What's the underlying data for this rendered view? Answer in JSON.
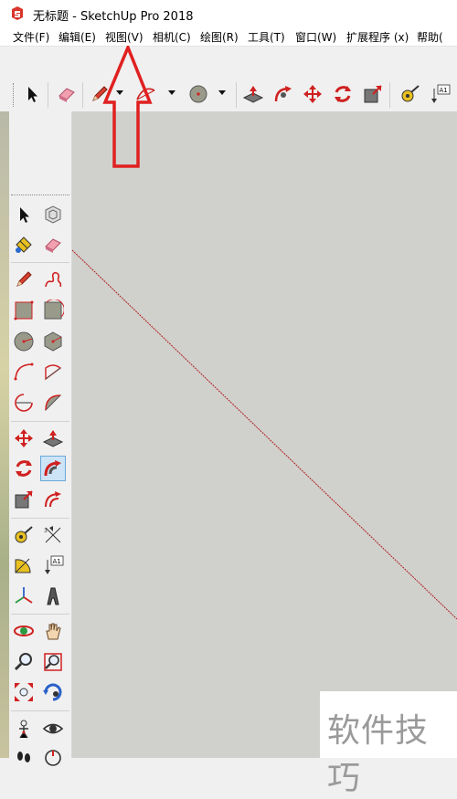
{
  "window": {
    "title": "无标题 - SketchUp Pro 2018"
  },
  "menu": [
    {
      "label": "文件(F)"
    },
    {
      "label": "编辑(E)"
    },
    {
      "label": "视图(V)"
    },
    {
      "label": "相机(C)"
    },
    {
      "label": "绘图(R)"
    },
    {
      "label": "工具(T)"
    },
    {
      "label": "窗口(W)"
    },
    {
      "label": "扩展程序 (x)"
    },
    {
      "label": "帮助("
    }
  ],
  "toolbar_icons": [
    "select-icon",
    "eraser-icon",
    "pencil-icon",
    "arc-icon",
    "circle-icon",
    "push-pull-icon",
    "follow-me-icon",
    "move-icon",
    "rotate-icon",
    "scale-icon",
    "tape-measure-icon",
    "text-icon"
  ],
  "left_tools": [
    "select-icon",
    "component-icon",
    "paint-bucket-icon",
    "eraser-icon",
    "line-icon",
    "freehand-icon",
    "rectangle-icon",
    "rotated-rectangle-icon",
    "circle-icon",
    "polygon-icon",
    "arc-icon",
    "pie-icon",
    "two-point-arc-icon",
    "three-point-arc-icon",
    "move-icon",
    "push-pull-icon",
    "rotate-icon",
    "follow-me-icon",
    "scale-icon",
    "offset-icon",
    "tape-measure-icon",
    "dimension-icon",
    "protractor-icon",
    "text-icon",
    "axes-icon",
    "3d-text-icon",
    "orbit-icon",
    "pan-icon",
    "zoom-icon",
    "zoom-window-icon",
    "zoom-extents-icon",
    "previous-view-icon",
    "position-camera-icon",
    "look-around-icon",
    "walk-icon",
    "section-plane-icon"
  ],
  "watermark": {
    "text": "软件技巧"
  },
  "colors": {
    "canvas": "#d0d0cc",
    "accent_red": "#e02020",
    "axis_line": "#b02020"
  }
}
